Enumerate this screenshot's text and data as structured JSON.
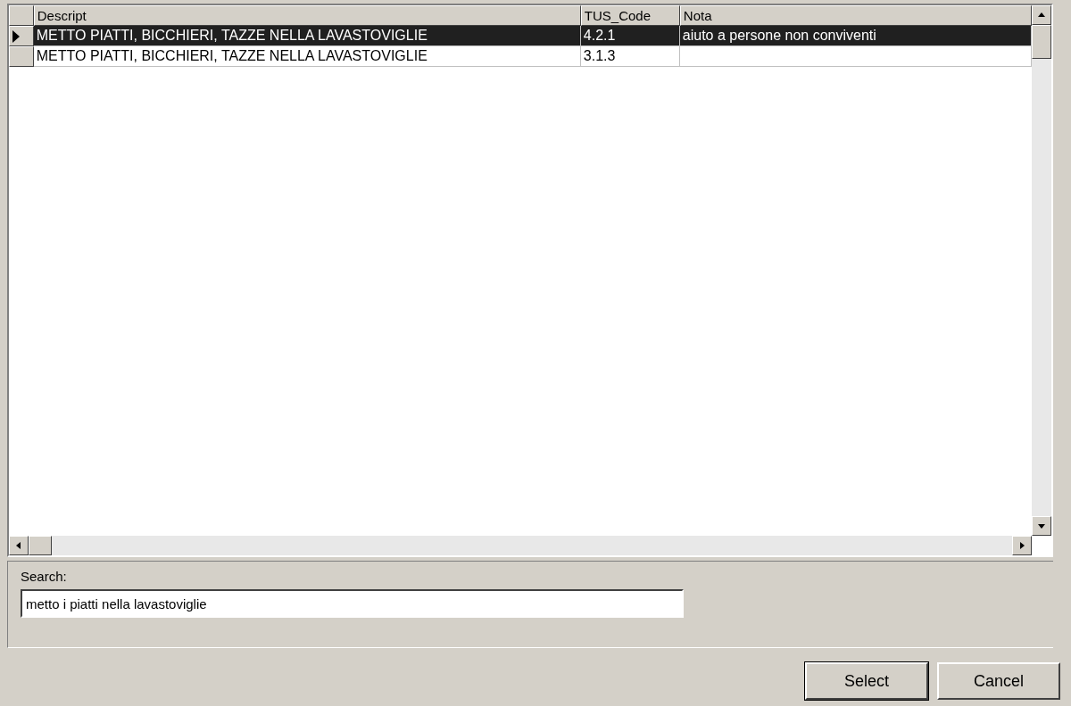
{
  "table": {
    "columns": [
      "Descript",
      "TUS_Code",
      "Nota"
    ],
    "rows": [
      {
        "selected": true,
        "cells": [
          "METTO PIATTI, BICCHIERI, TAZZE NELLA LAVASTOVIGLIE",
          "4.2.1",
          "aiuto a persone non conviventi"
        ]
      },
      {
        "selected": false,
        "cells": [
          "METTO PIATTI, BICCHIERI, TAZZE NELLA LAVASTOVIGLIE",
          "3.1.3",
          ""
        ]
      }
    ]
  },
  "search": {
    "label": "Search:",
    "value": "metto i piatti nella lavastoviglie"
  },
  "buttons": [
    {
      "label": "Select",
      "default": true
    },
    {
      "label": "Cancel",
      "default": false
    }
  ]
}
